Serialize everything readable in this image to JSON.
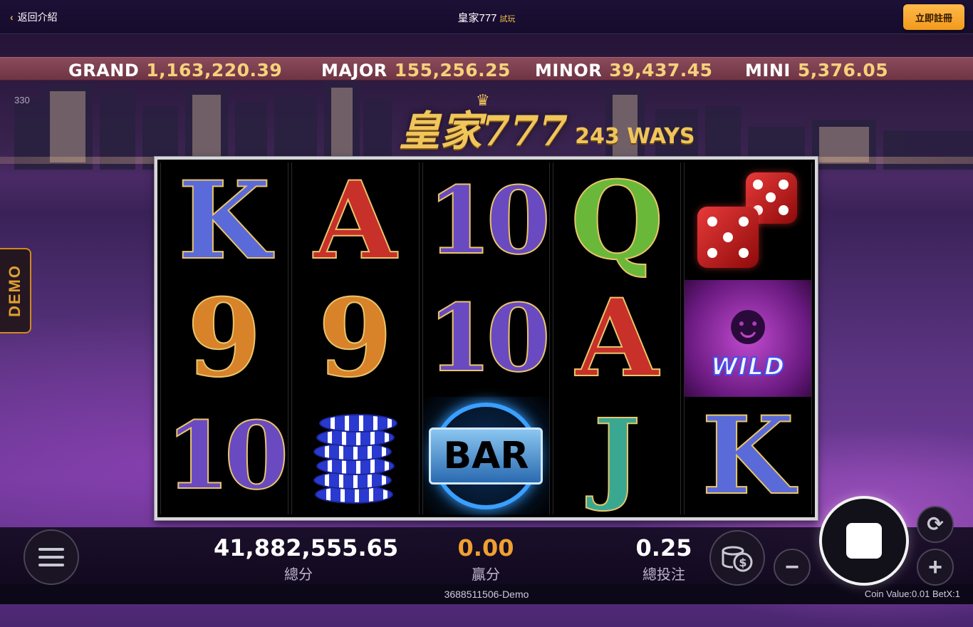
{
  "topbar": {
    "back_label": "返回介紹",
    "title": "皇家777",
    "trial_label": "試玩",
    "register_label": "立即註冊"
  },
  "jackpots": [
    {
      "label": "GRAND",
      "value": "1,163,220.39"
    },
    {
      "label": "MAJOR",
      "value": "155,256.25"
    },
    {
      "label": "MINOR",
      "value": "39,437.45"
    },
    {
      "label": "MINI",
      "value": "5,376.05"
    }
  ],
  "fps_readout": "330",
  "demo_tab_label": "DEMO",
  "logo": {
    "title": "皇家777",
    "ways": "243 WAYS"
  },
  "reels": [
    [
      "K",
      "9",
      "10"
    ],
    [
      "A",
      "9",
      "chips"
    ],
    [
      "10",
      "10",
      "BAR"
    ],
    [
      "Q",
      "A",
      "J"
    ],
    [
      "dice",
      "WILD",
      "K"
    ]
  ],
  "symbols": {
    "bar_label": "BAR",
    "wild_label": "WILD"
  },
  "stats": {
    "balance": {
      "value": "41,882,555.65",
      "label": "總分"
    },
    "win": {
      "value": "0.00",
      "label": "贏分"
    },
    "total_bet": {
      "value": "0.25",
      "label": "總投注"
    }
  },
  "footer": {
    "session_id": "3688511506-Demo",
    "coin_info": "Coin Value:0.01  BetX:1"
  },
  "colors": {
    "accent": "#f29a1c",
    "jackpot_value": "#f6d17a",
    "win_value": "#f0a030",
    "jackpot_bar": "#7a3e4e"
  },
  "icons": {
    "menu": "hamburger-icon",
    "coins": "coin-stack-icon",
    "minus": "minus-icon",
    "plus": "plus-icon",
    "autoplay": "refresh-icon",
    "spin": "stop-square-icon"
  }
}
